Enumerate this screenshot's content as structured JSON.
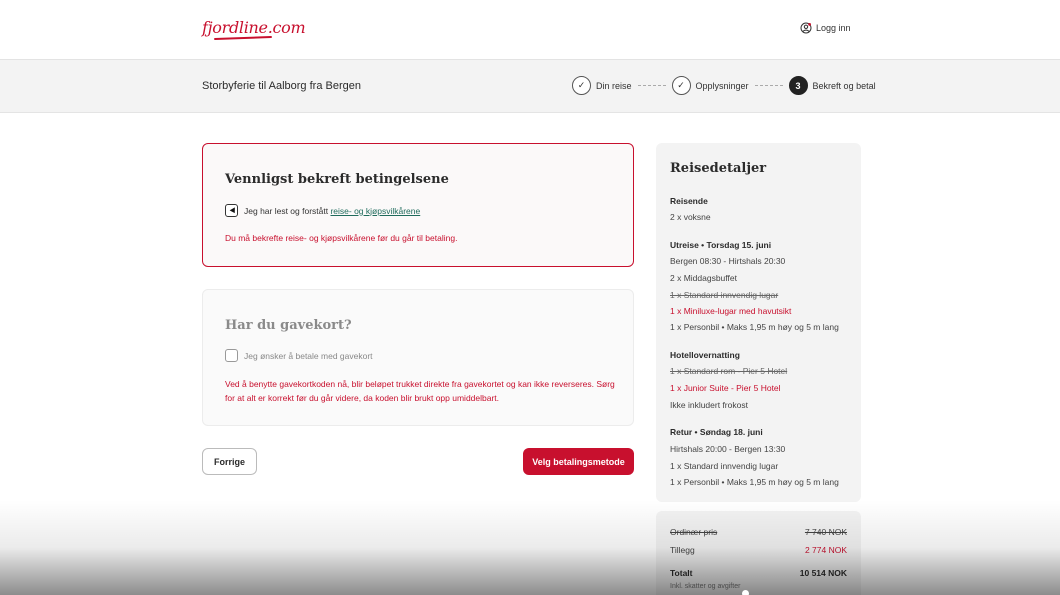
{
  "header": {
    "logo": "fjordline.com",
    "login_label": "Logg inn",
    "login_icon": "user-circle-icon"
  },
  "subheader": {
    "trip_title": "Storbyferie til Aalborg fra Bergen",
    "steps": [
      {
        "label": "Din reise",
        "marker": "✓"
      },
      {
        "label": "Opplysninger",
        "marker": "✓"
      },
      {
        "label": "Bekreft og betal",
        "marker": "3"
      }
    ]
  },
  "confirm": {
    "title": "Vennligst bekreft betingelsene",
    "checkbox_text": "Jeg har lest og forstått ",
    "terms_link": "reise- og kjøpsvilkårene",
    "error": "Du må bekrefte reise- og kjøpsvilkårene før du går til betaling."
  },
  "gift": {
    "title": "Har du gavekort?",
    "checkbox_text": "Jeg ønsker å betale med gavekort",
    "info": "Ved å benytte gavekortkoden nå, blir beløpet trukket direkte fra gavekortet og kan ikke reverseres. Sørg for at alt er korrekt før du går videre, da koden blir brukt opp umiddelbart."
  },
  "actions": {
    "prev_label": "Forrige",
    "next_label": "Velg betalingsmetode"
  },
  "details": {
    "title": "Reisedetaljer",
    "lines": [
      {
        "text": "Reisende",
        "style": "head"
      },
      {
        "text": "2 x voksne",
        "style": ""
      },
      {
        "text": "Utreise • Torsdag 15. juni",
        "style": "head"
      },
      {
        "text": "Bergen 08:30 - Hirtshals 20:30",
        "style": ""
      },
      {
        "text": "2 x Middagsbuffet",
        "style": ""
      },
      {
        "text": "1 x Standard innvendig lugar",
        "style": "strike"
      },
      {
        "text": "1 x Miniluxe-lugar med havutsikt",
        "style": "red"
      },
      {
        "text": "1 x Personbil • Maks 1,95 m høy og 5 m lang",
        "style": ""
      },
      {
        "text": "Hotellovernatting",
        "style": "head"
      },
      {
        "text": "1 x Standard rom - Pier 5 Hotel",
        "style": "strike"
      },
      {
        "text": "1 x Junior Suite - Pier 5 Hotel",
        "style": "red"
      },
      {
        "text": "Ikke inkludert frokost",
        "style": ""
      },
      {
        "text": "Retur • Søndag 18. juni",
        "style": "head"
      },
      {
        "text": "Hirtshals 20:00 - Bergen 13:30",
        "style": ""
      },
      {
        "text": "1 x Standard innvendig lugar",
        "style": ""
      },
      {
        "text": "1 x Personbil • Maks 1,95 m høy og 5 m lang",
        "style": ""
      }
    ]
  },
  "prices": {
    "ordinary_label": "Ordinær pris",
    "ordinary_value": "7 740 NOK",
    "extra_label": "Tillegg",
    "extra_value": "2 774 NOK",
    "total_label": "Totalt",
    "total_value": "10 514 NOK",
    "total_note": "Inkl. skatter og avgifter"
  },
  "colors": {
    "brand": "#c8102e",
    "link": "#1f6b5c"
  }
}
